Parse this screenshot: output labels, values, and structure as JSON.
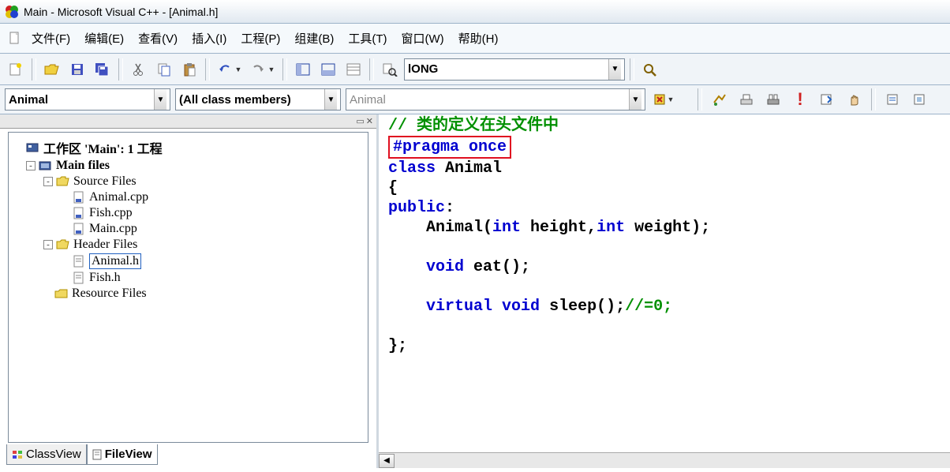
{
  "title": "Main - Microsoft Visual C++ - [Animal.h]",
  "menus": [
    "文件(F)",
    "编辑(E)",
    "查看(V)",
    "插入(I)",
    "工程(P)",
    "组建(B)",
    "工具(T)",
    "窗口(W)",
    "帮助(H)"
  ],
  "searchbox": "lONG",
  "class_combo1": "Animal",
  "class_combo2": "(All class members)",
  "class_combo3": "Animal",
  "workspace_label": "工作区 'Main': 1 工程",
  "tree": {
    "project": "Main files",
    "source_folder": "Source Files",
    "sources": [
      "Animal.cpp",
      "Fish.cpp",
      "Main.cpp"
    ],
    "header_folder": "Header Files",
    "headers": [
      "Animal.h",
      "Fish.h"
    ],
    "resource_folder": "Resource Files"
  },
  "tabs": {
    "classview": "ClassView",
    "fileview": "FileView"
  },
  "code": {
    "comment": "// 类的定义在头文件中",
    "pragma": "#pragma once",
    "line1": "class",
    "line1b": " Animal",
    "line2": "{",
    "line3a": "public",
    "line3b": ":",
    "line4a": "    Animal(",
    "line4b": "int",
    "line4c": " height,",
    "line4d": "int",
    "line4e": " weight);",
    "line5": "",
    "line6a": "    ",
    "line6b": "void",
    "line6c": " eat();",
    "line7": "",
    "line8a": "    ",
    "line8b": "virtual",
    "line8c": " ",
    "line8d": "void",
    "line8e": " sleep();",
    "line8f": "//=0;",
    "line9": "",
    "line10": "};"
  }
}
